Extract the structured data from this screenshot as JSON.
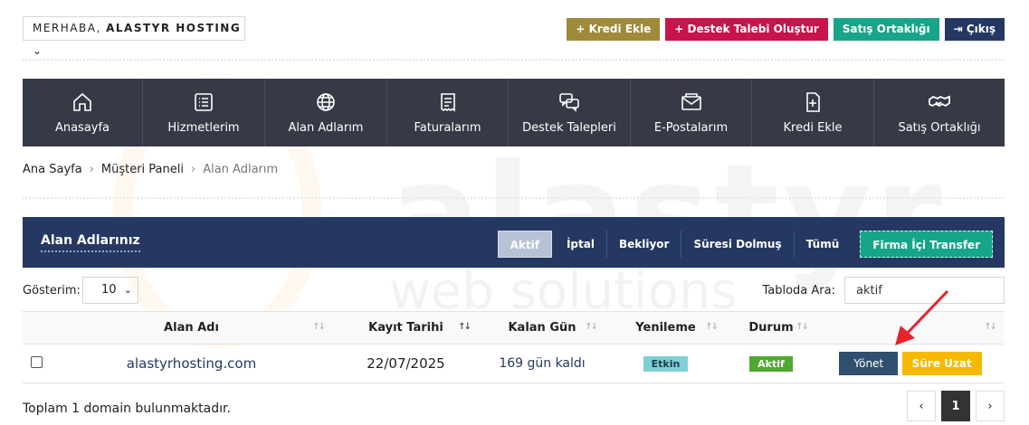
{
  "header": {
    "greeting_prefix": "MERHABA,",
    "user_name": "ALASTYR HOSTING",
    "buttons": [
      {
        "label": "+ Kredi Ekle",
        "color": "#9e8a3a"
      },
      {
        "label": "+ Destek Talebi Oluştur",
        "color": "#c8134b"
      },
      {
        "label": "Satış Ortaklığı",
        "color": "#17a589"
      },
      {
        "label": "Çıkış",
        "color": "#243862"
      }
    ]
  },
  "nav": [
    {
      "label": "Anasayfa",
      "icon": "home-icon"
    },
    {
      "label": "Hizmetlerim",
      "icon": "list-icon"
    },
    {
      "label": "Alan Adlarım",
      "icon": "globe-icon"
    },
    {
      "label": "Faturalarım",
      "icon": "invoice-icon"
    },
    {
      "label": "Destek Talepleri",
      "icon": "chat-icon"
    },
    {
      "label": "E-Postalarım",
      "icon": "mail-icon"
    },
    {
      "label": "Kredi Ekle",
      "icon": "file-plus-icon"
    },
    {
      "label": "Satış Ortaklığı",
      "icon": "handshake-icon"
    }
  ],
  "breadcrumb": [
    "Ana Sayfa",
    "Müşteri Paneli",
    "Alan Adlarım"
  ],
  "panel": {
    "title": "Alan Adlarınız",
    "filters": [
      "Aktif",
      "İptal",
      "Bekliyor",
      "Süresi Dolmuş",
      "Tümü"
    ],
    "transfer_label": "Firma İçi Transfer"
  },
  "controls": {
    "show_label": "Gösterim:",
    "show_value": "10",
    "search_label": "Tabloda Ara:",
    "search_value": "aktif"
  },
  "table": {
    "headers": [
      "Alan Adı",
      "Kayıt Tarihi",
      "Kalan Gün",
      "Yenileme",
      "Durum"
    ],
    "rows": [
      {
        "domain": "alastyrhosting.com",
        "date": "22/07/2025",
        "remaining": "169 gün kaldı",
        "renewal": "Etkin",
        "status": "Aktif",
        "manage": "Yönet",
        "extend": "Süre Uzat"
      }
    ]
  },
  "footer": {
    "total": "Toplam 1 domain bulunmaktadır.",
    "pages": [
      "‹",
      "1",
      "›"
    ]
  },
  "watermark": {
    "main": "alastyr",
    "sub": "web solutions"
  }
}
